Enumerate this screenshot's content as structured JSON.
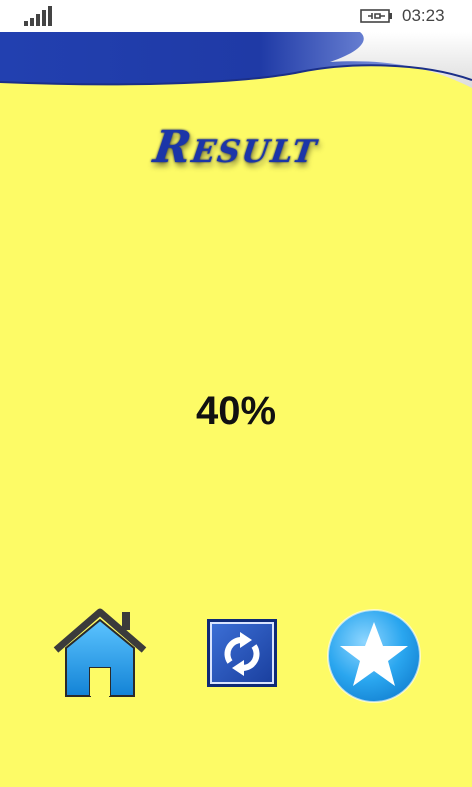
{
  "status_bar": {
    "time": "03:23",
    "icons": [
      "signal-bars-icon",
      "battery-charging-icon"
    ]
  },
  "title": "Result",
  "score": "40%",
  "actions": [
    {
      "name": "home",
      "icon": "home-icon"
    },
    {
      "name": "retry",
      "icon": "refresh-arrows-icon"
    },
    {
      "name": "rate",
      "icon": "star-icon"
    }
  ],
  "colors": {
    "background": "#fdfb66",
    "title": "#1b35a8",
    "banner_blue": "#1f3aa6",
    "home_blue": "#1e9be9",
    "star_blue": "#2aa6ef"
  }
}
